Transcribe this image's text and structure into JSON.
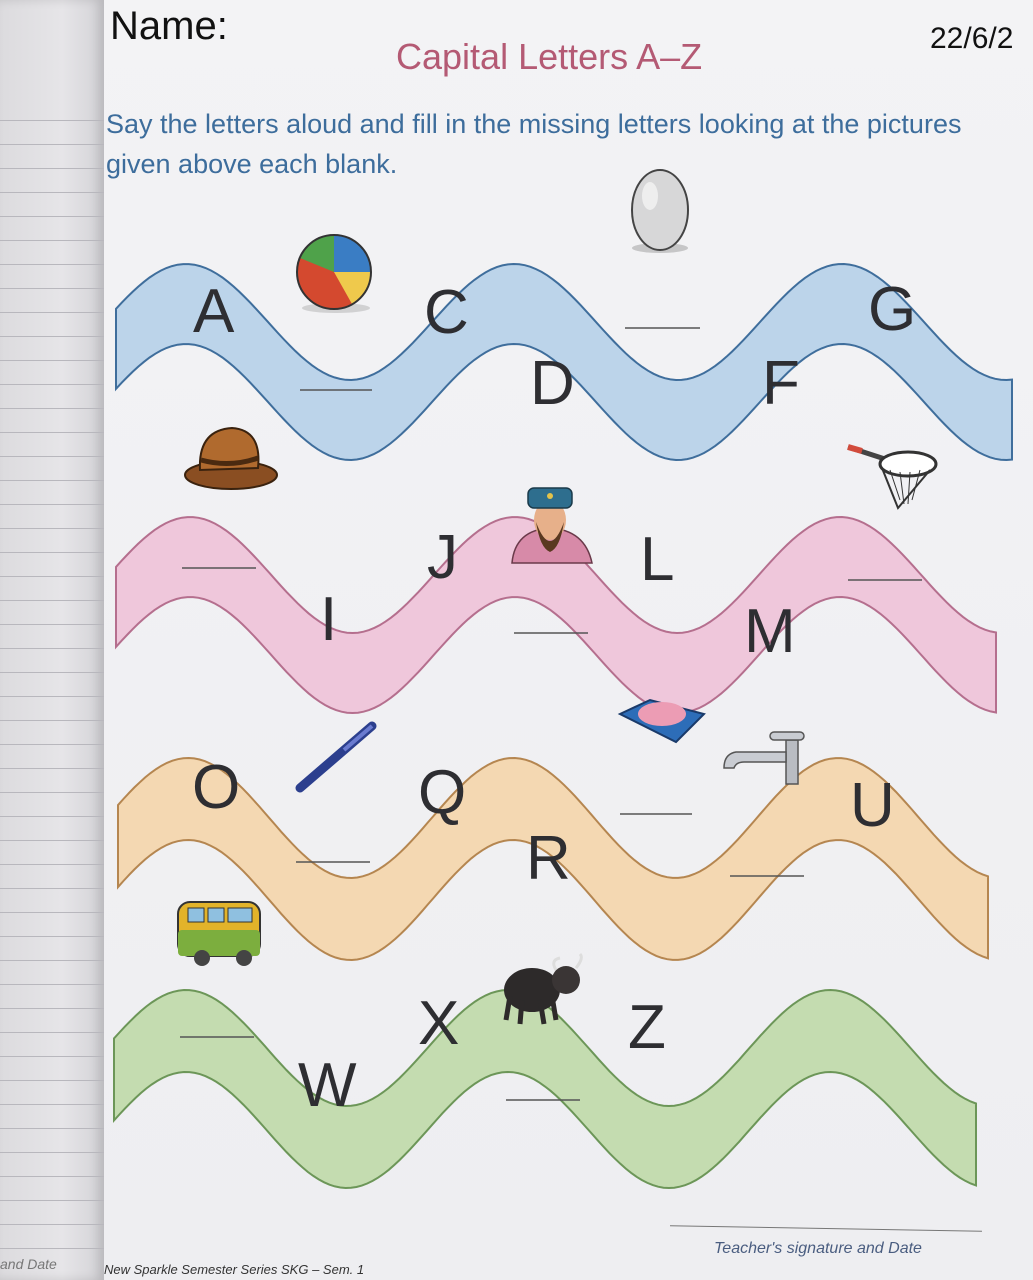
{
  "header": {
    "name_label": "Name:",
    "date": "22/6/2",
    "title": "Capital Letters A–Z"
  },
  "instructions": {
    "line1": "Say the letters aloud and fill in the missing letters looking at the pictures",
    "line2": "given above each blank."
  },
  "rows": [
    {
      "color": "#bcd4ea",
      "stroke": "#3f6e9c",
      "letters": [
        "A",
        "C",
        "D",
        "F",
        "G"
      ],
      "pictures": [
        "ball",
        "egg"
      ]
    },
    {
      "color": "#efc7db",
      "stroke": "#b56f8e",
      "letters": [
        "J",
        "I",
        "L",
        "M"
      ],
      "pictures": [
        "hat",
        "king",
        "net"
      ]
    },
    {
      "color": "#f4d8b2",
      "stroke": "#b58650",
      "letters": [
        "O",
        "Q",
        "R",
        "U"
      ],
      "pictures": [
        "pen",
        "soap",
        "tap"
      ]
    },
    {
      "color": "#c4dcb0",
      "stroke": "#6c9658",
      "letters": [
        "W",
        "X",
        "Z"
      ],
      "pictures": [
        "van",
        "yak"
      ]
    }
  ],
  "footer": {
    "left_page_fragment": "and Date",
    "book_title": "New Sparkle Semester Series SKG – Sem. 1",
    "teacher_signature": "Teacher's signature and Date"
  }
}
